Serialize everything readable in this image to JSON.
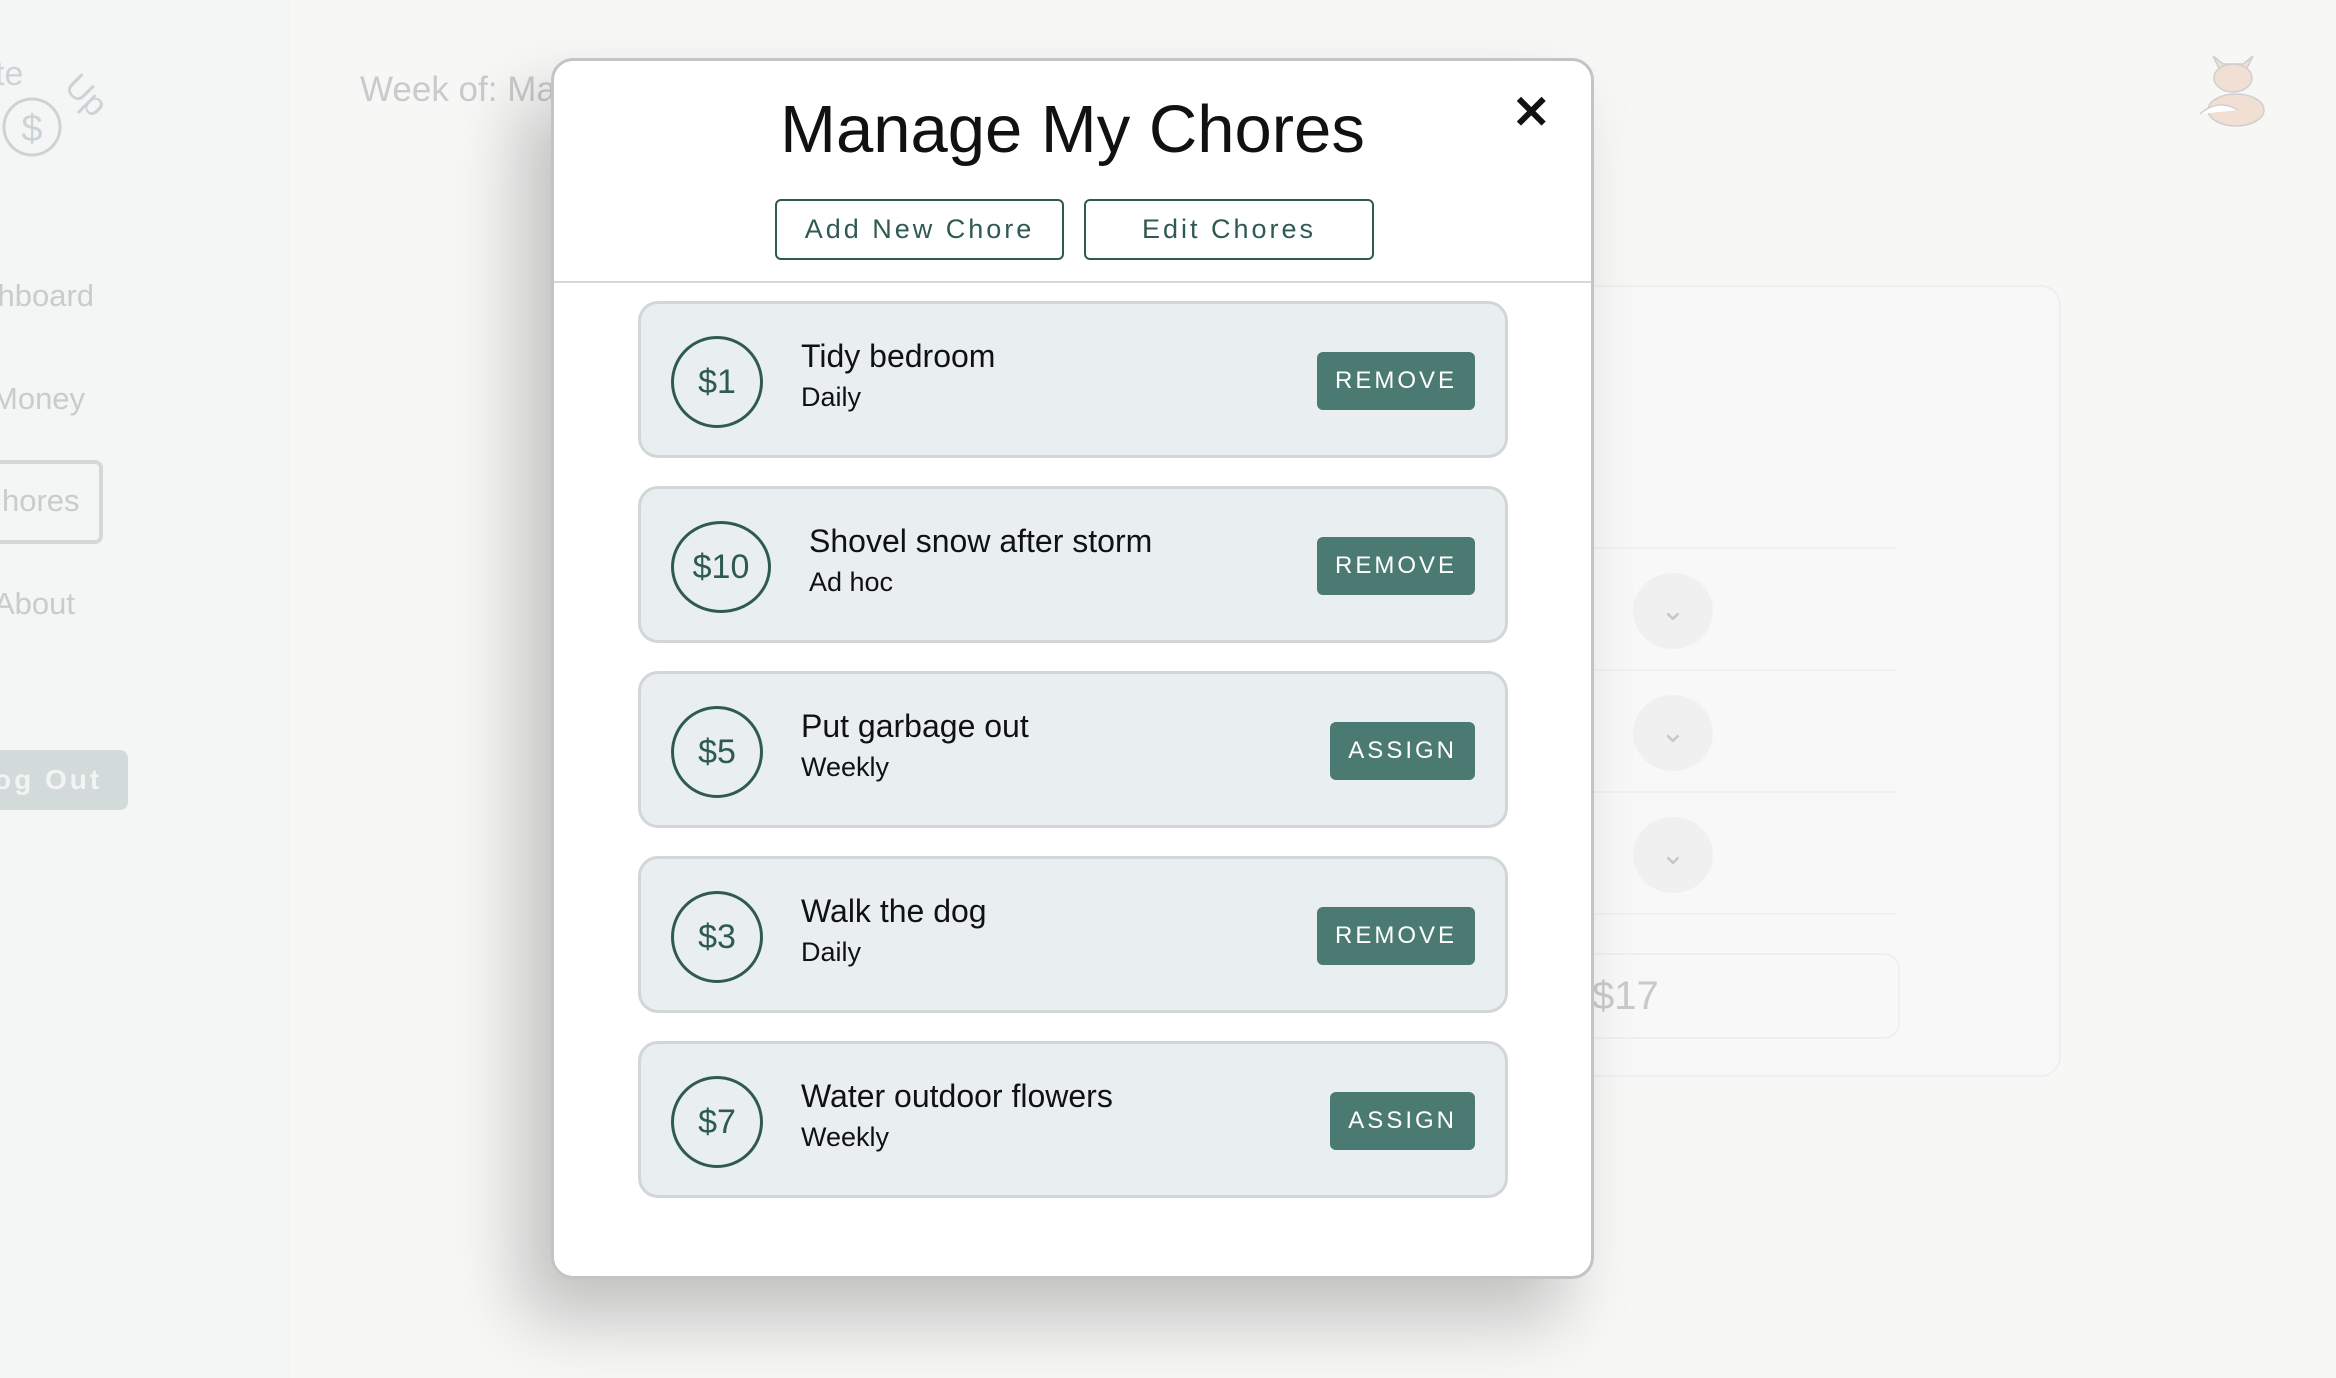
{
  "app": {
    "logo_text": "ite Up"
  },
  "sidebar": {
    "items": [
      {
        "label": "shboard"
      },
      {
        "label": "Money"
      },
      {
        "label": "hores"
      },
      {
        "label": "About"
      }
    ],
    "logout": "og Out"
  },
  "header": {
    "week": "Week of: Ma"
  },
  "background": {
    "total": "$17"
  },
  "modal": {
    "title": "Manage My Chores",
    "add_label": "Add New Chore",
    "edit_label": "Edit Chores",
    "chores": [
      {
        "amount": "$1",
        "name": "Tidy bedroom",
        "frequency": "Daily",
        "action": "REMOVE"
      },
      {
        "amount": "$10",
        "name": "Shovel snow after storm",
        "frequency": "Ad hoc",
        "action": "REMOVE"
      },
      {
        "amount": "$5",
        "name": "Put garbage out",
        "frequency": "Weekly",
        "action": "ASSIGN"
      },
      {
        "amount": "$3",
        "name": "Walk the dog",
        "frequency": "Daily",
        "action": "REMOVE"
      },
      {
        "amount": "$7",
        "name": "Water outdoor flowers",
        "frequency": "Weekly",
        "action": "ASSIGN"
      }
    ]
  },
  "colors": {
    "accent": "#4a7a72",
    "accent_dark": "#2f5a52",
    "card_bg": "#e9eef0"
  },
  "icons": {
    "close": "close-icon",
    "avatar": "fox-avatar-icon",
    "chevron": "chevron-down-icon",
    "logo": "dollar-logo-icon"
  }
}
